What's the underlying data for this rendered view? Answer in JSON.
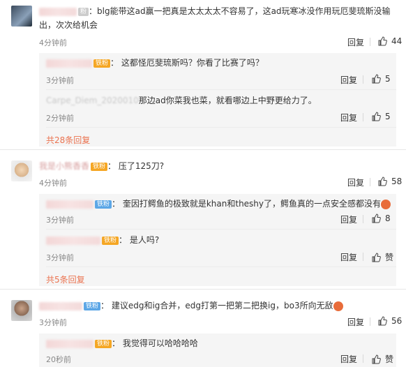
{
  "comments": [
    {
      "text": "blg能带这ad赢一把真是太太太太不容易了，这ad玩寒冰没作用玩厄斐琉斯没输出，次次给机会",
      "time": "4分钟前",
      "reply": "回复",
      "likes": "44",
      "subs": [
        {
          "badge": "铁粉",
          "text": "这都怪厄斐琉斯吗？你看了比赛了吗？",
          "time": "3分钟前",
          "reply": "回复",
          "likes": "5"
        },
        {
          "name": "Carpe_Diem_2020010",
          "text": "那边ad你菜我也菜，就看哪边上中野更给力了。",
          "time": "2分钟前",
          "reply": "回复",
          "likes": "5"
        }
      ],
      "more": "共28条回复"
    },
    {
      "name": "我是小熊香香",
      "badge": "铁粉",
      "text": "压了125刀?",
      "time": "4分钟前",
      "reply": "回复",
      "likes": "58",
      "subs": [
        {
          "badge": "铁粉",
          "text": "奎因打鳄鱼的极致就是khan和theshy了，鳄鱼真的一点安全感都没有",
          "time": "3分钟前",
          "reply": "回复",
          "likes": "8"
        },
        {
          "badge": "铁粉",
          "text": "是人吗?",
          "time": "3分钟前",
          "reply": "回复",
          "likes": "赞"
        }
      ],
      "more": "共5条回复"
    },
    {
      "badge": "铁粉",
      "text": "建议edg和ig合并，edg打第一把第二把换ig，bo3所向无敌",
      "time": "3分钟前",
      "reply": "回复",
      "likes": "56",
      "subs": [
        {
          "badge": "铁粉",
          "text": "我觉得可以哈哈哈哈",
          "time": "20秒前",
          "reply": "回复",
          "likes": "赞"
        }
      ]
    }
  ],
  "icons": {
    "like": "thumbs-up-icon",
    "emoji": "emoji-icon"
  },
  "colors": {
    "more": "#eb7350",
    "badge": "#f5a623",
    "badge_blue": "#5ba6e6"
  }
}
